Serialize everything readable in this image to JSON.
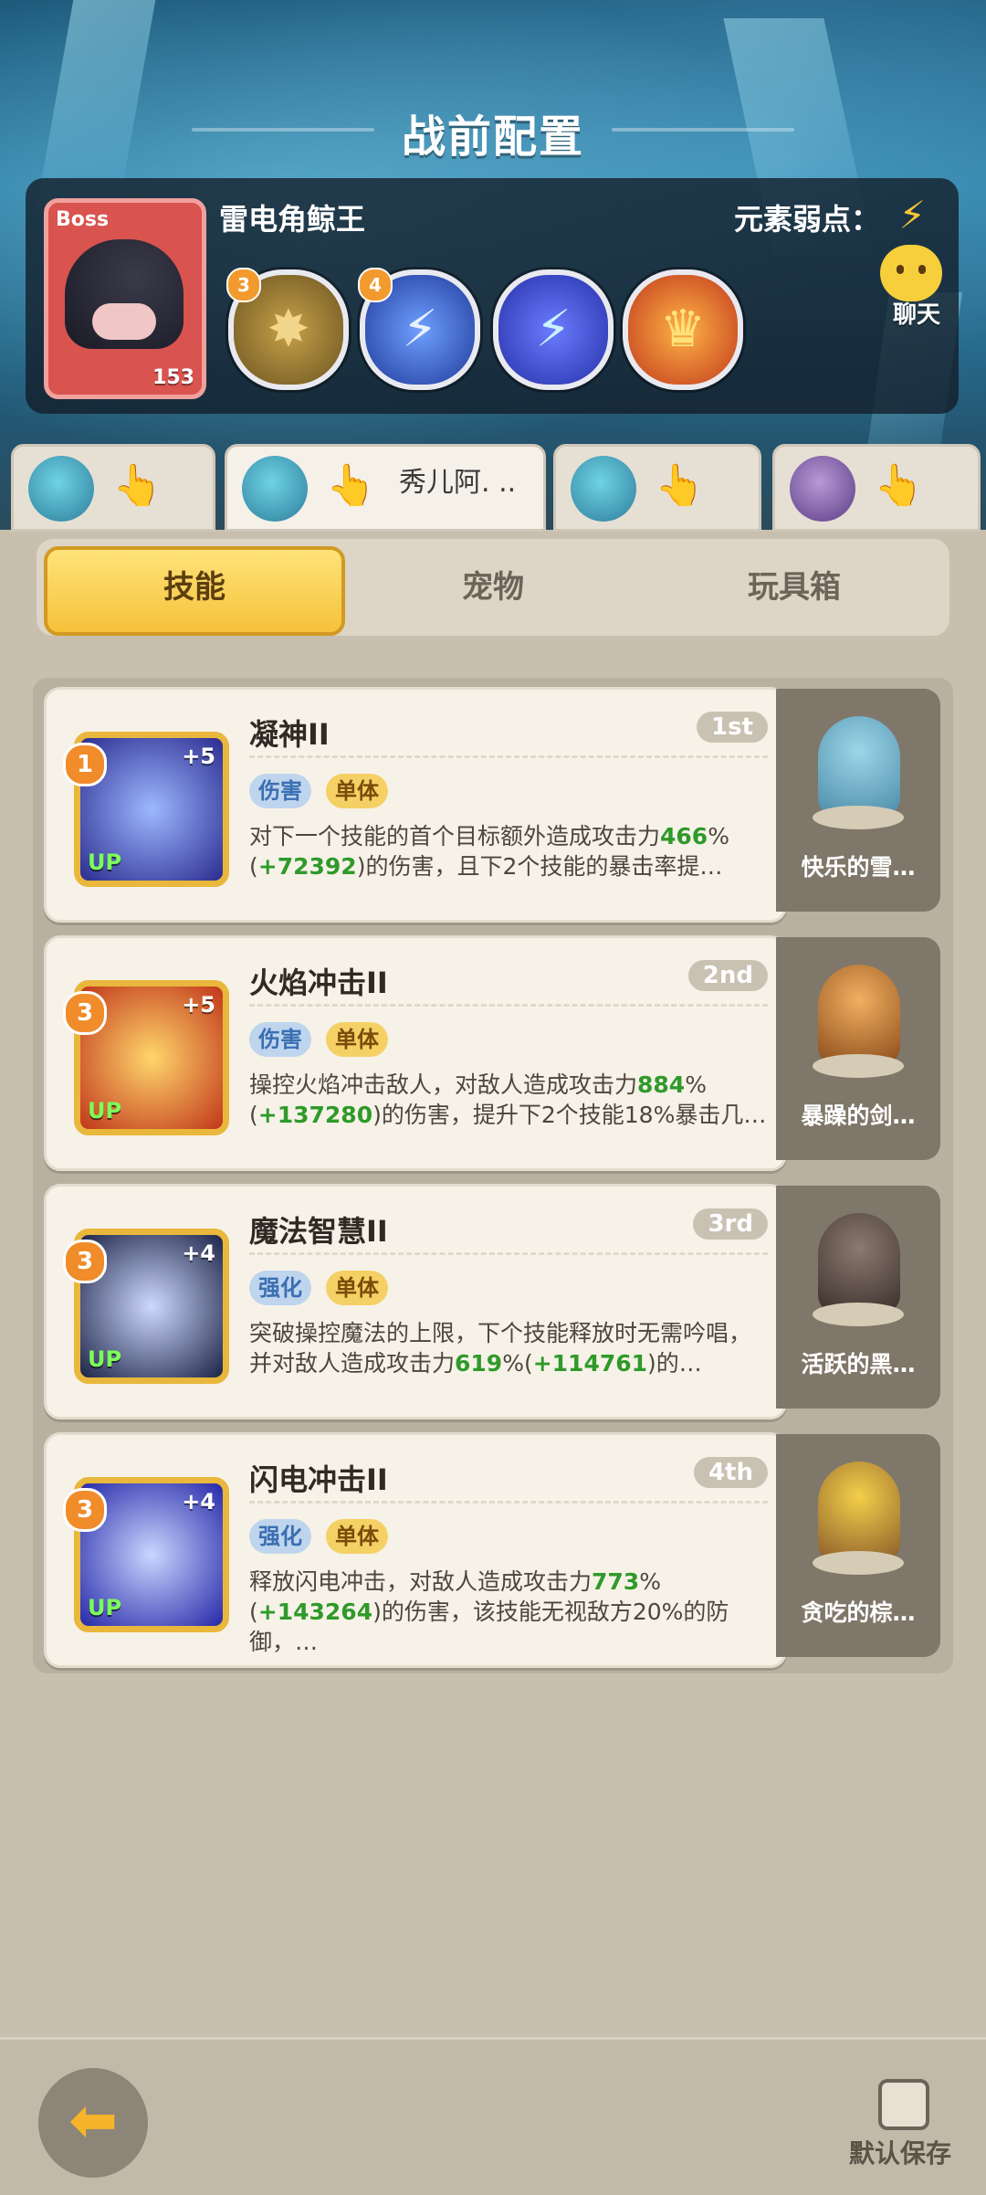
{
  "header": {
    "title": "战前配置"
  },
  "boss": {
    "badge": "Boss",
    "level": "153",
    "name": "雷电角鲸王",
    "weakness_label": "元素弱点：",
    "weakness_icon": "lightning-icon",
    "skills": [
      {
        "level": "3",
        "icon": "stone-spike-icon"
      },
      {
        "level": "4",
        "icon": "lightning-storm-icon"
      },
      {
        "level": "",
        "icon": "lightning-bolt-icon"
      },
      {
        "level": "",
        "icon": "crown-icon"
      }
    ]
  },
  "chat": {
    "label": "聊天"
  },
  "party": [
    {
      "name": ""
    },
    {
      "name": "秀儿阿. .."
    },
    {
      "name": ""
    },
    {
      "name": ""
    }
  ],
  "tabs": [
    {
      "label": "技能",
      "active": true
    },
    {
      "label": "宠物",
      "active": false
    },
    {
      "label": "玩具箱",
      "active": false
    }
  ],
  "skills": [
    {
      "name": "凝神II",
      "rank": "1st",
      "level": "1",
      "plus": "+5",
      "up": "UP",
      "tags": [
        "伤害",
        "单体"
      ],
      "desc_a": "对下一个技能的首个目标额外造成攻击力",
      "v1": "466",
      "desc_b": "%(",
      "v2": "+72392",
      "desc_c": ")的伤害，且下2个技能的暴击率提…",
      "pet_name": "快乐的雪…"
    },
    {
      "name": "火焰冲击II",
      "rank": "2nd",
      "level": "3",
      "plus": "+5",
      "up": "UP",
      "tags": [
        "伤害",
        "单体"
      ],
      "desc_a": "操控火焰冲击敌人，对敌人造成攻击力",
      "v1": "884",
      "desc_b": "%(",
      "v2": "+137280",
      "desc_c": ")的伤害，提升下2个技能18%暴击几…",
      "pet_name": "暴躁的剑…"
    },
    {
      "name": "魔法智慧II",
      "rank": "3rd",
      "level": "3",
      "plus": "+4",
      "up": "UP",
      "tags": [
        "强化",
        "单体"
      ],
      "desc_a": "突破操控魔法的上限，下个技能释放时无需吟唱，并对敌人造成攻击力",
      "v1": "619",
      "desc_b": "%(",
      "v2": "+114761",
      "desc_c": ")的…",
      "pet_name": "活跃的黑…"
    },
    {
      "name": "闪电冲击II",
      "rank": "4th",
      "level": "3",
      "plus": "+4",
      "up": "UP",
      "tags": [
        "强化",
        "单体"
      ],
      "desc_a": "释放闪电冲击，对敌人造成攻击力",
      "v1": "773",
      "desc_b": "%(",
      "v2": "+143264",
      "desc_c": ")的伤害，该技能无视敌方20%的防御，…",
      "pet_name": "贪吃的棕…"
    }
  ],
  "footer": {
    "save_label": "默认保存",
    "back_icon": "back-arrow-icon"
  }
}
